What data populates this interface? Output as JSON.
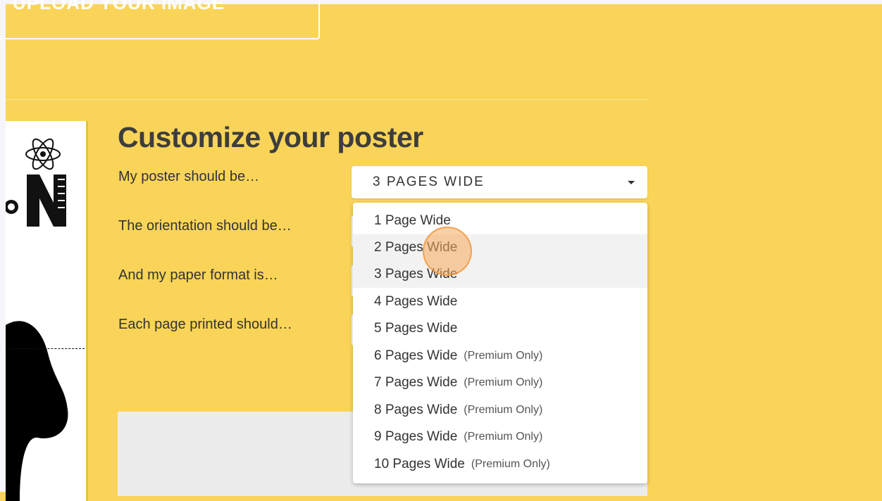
{
  "upload_button": {
    "label": "UPLOAD YOUR IMAGE"
  },
  "title": "Customize your poster",
  "form": {
    "labels": [
      "My poster should be…",
      "The orientation should be…",
      "And my paper format is…",
      "Each page printed should…"
    ],
    "size_select": {
      "value": "3 PAGES WIDE"
    }
  },
  "dropdown": {
    "options": [
      {
        "label": "1 Page Wide",
        "note": ""
      },
      {
        "label": "2 Pages Wide",
        "note": ""
      },
      {
        "label": "3 Pages Wide",
        "note": ""
      },
      {
        "label": "4 Pages Wide",
        "note": ""
      },
      {
        "label": "5 Pages Wide",
        "note": ""
      },
      {
        "label": "6 Pages Wide",
        "note": "(Premium Only)"
      },
      {
        "label": "7 Pages Wide",
        "note": "(Premium Only)"
      },
      {
        "label": "8 Pages Wide",
        "note": "(Premium Only)"
      },
      {
        "label": "9 Pages Wide",
        "note": "(Premium Only)"
      },
      {
        "label": "10 Pages Wide",
        "note": "(Premium Only)"
      }
    ],
    "highlighted_index": 1,
    "selected_index": 2
  },
  "colors": {
    "background": "#f9d458",
    "title": "#3d3d3d",
    "text": "#333333",
    "highlight_row": "#f2f2f2",
    "cursor": "#f7aa5a"
  },
  "icons": [
    "atom-icon",
    "dropdown-caret-icon"
  ]
}
